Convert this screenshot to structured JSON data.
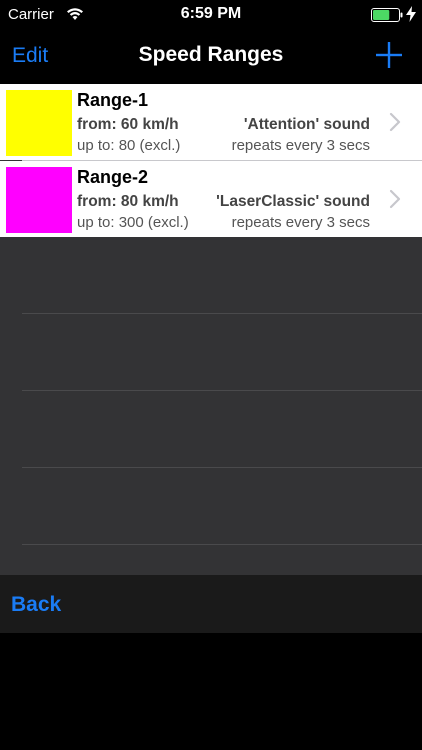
{
  "status_bar": {
    "carrier": "Carrier",
    "time": "6:59 PM",
    "battery_level": 0.65,
    "battery_color": "#4cd964"
  },
  "nav": {
    "edit_label": "Edit",
    "title": "Speed Ranges",
    "add_icon": "plus-icon",
    "accent_color": "#1a7cf5"
  },
  "ranges": [
    {
      "name": "Range-1",
      "from": "from: 60 km/h",
      "up_to": "up to: 80 (excl.)",
      "sound": "'Attention' sound",
      "repeat": "repeats every 3 secs",
      "color": "#ffff00"
    },
    {
      "name": "Range-2",
      "from": "from: 80 km/h",
      "up_to": "up to: 300 (excl.)",
      "sound": "'LaserClassic' sound",
      "repeat": "repeats every 3 secs",
      "color": "#ff00ff"
    }
  ],
  "toolbar": {
    "back_label": "Back"
  }
}
